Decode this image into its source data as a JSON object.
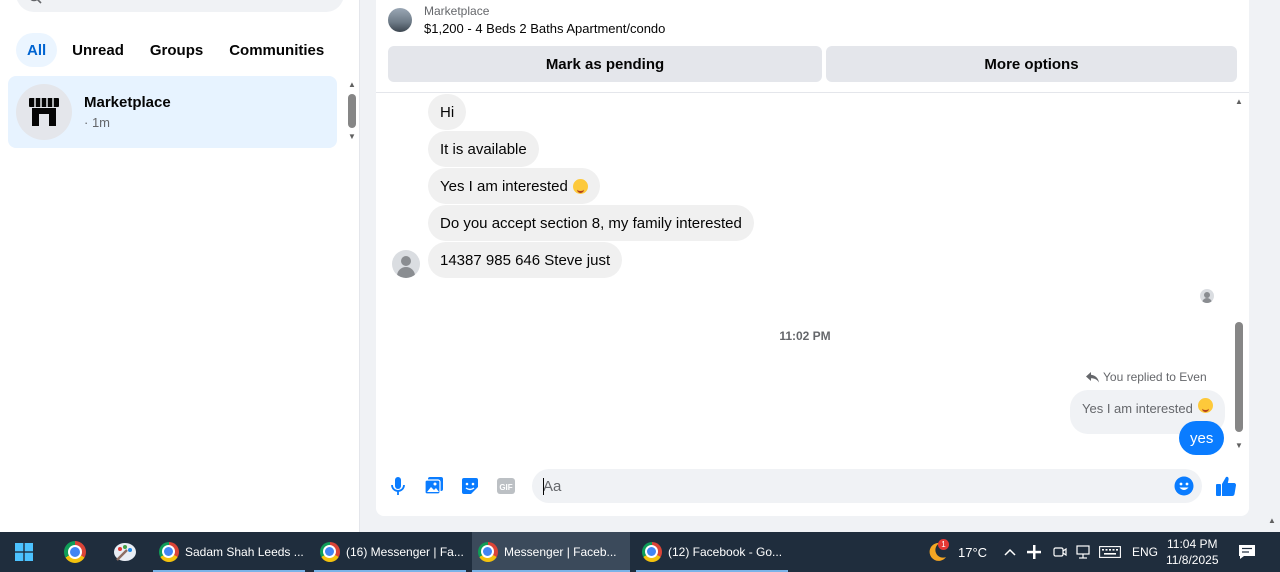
{
  "sidebar": {
    "filters": [
      "All",
      "Unread",
      "Groups",
      "Communities"
    ],
    "active_filter": "All",
    "conversation": {
      "name": "Marketplace",
      "meta": "· 1m"
    }
  },
  "chat": {
    "listing": {
      "category": "Marketplace",
      "title": "$1,200 - 4 Beds 2 Baths Apartment/condo"
    },
    "buttons": {
      "pending": "Mark as pending",
      "more": "More options"
    },
    "incoming": [
      "Hi",
      "It is available",
      "Yes I am interested",
      "Do you accept section 8, my family interested",
      "14387 985 646 Steve just"
    ],
    "timestamp": "11:02 PM",
    "reply_note": "You replied to Even",
    "quoted": "Yes I am interested",
    "outgoing": "yes",
    "composer_placeholder": "Aa",
    "colors": {
      "accent": "#0a7cff",
      "bubble_in": "#f0f0f0",
      "active_conv": "#e7f3ff"
    }
  },
  "taskbar": {
    "tasks": [
      {
        "label": "Sadam Shah Leeds ..."
      },
      {
        "label": "(16) Messenger | Fa..."
      },
      {
        "label": "Messenger | Faceb..."
      },
      {
        "label": "(12) Facebook - Go..."
      }
    ],
    "weather": "17°C",
    "weather_badge": "1",
    "language": "ENG",
    "time": "11:04 PM",
    "date": "11/8/2025"
  }
}
